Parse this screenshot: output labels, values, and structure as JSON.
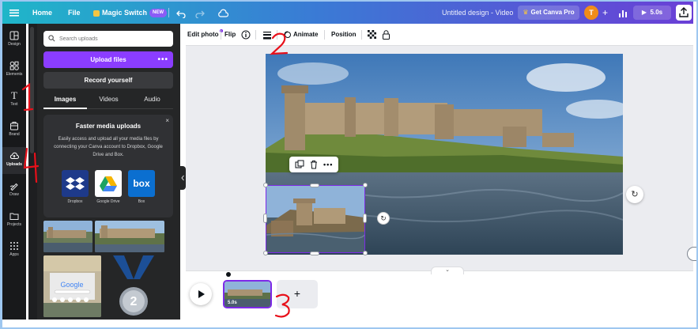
{
  "topbar": {
    "home": "Home",
    "file": "File",
    "magic_switch": "Magic Switch",
    "new_badge": "NEW",
    "doc_title": "Untitled design - Video",
    "get_pro": "Get Canva Pro",
    "avatar_initial": "T",
    "add": "+",
    "duration": "5.0s"
  },
  "rail": {
    "items": [
      {
        "label": "Design",
        "icon": "design-icon"
      },
      {
        "label": "Elements",
        "icon": "elements-icon"
      },
      {
        "label": "Text",
        "icon": "text-icon"
      },
      {
        "label": "Brand",
        "icon": "brand-icon"
      },
      {
        "label": "Uploads",
        "icon": "upload-icon"
      },
      {
        "label": "Draw",
        "icon": "draw-icon"
      },
      {
        "label": "Projects",
        "icon": "folder-icon"
      },
      {
        "label": "Apps",
        "icon": "apps-icon"
      }
    ]
  },
  "panel": {
    "search_placeholder": "Search uploads",
    "upload_button": "Upload files",
    "upload_more": "•••",
    "record_button": "Record yourself",
    "tabs": [
      "Images",
      "Videos",
      "Audio"
    ],
    "promo": {
      "close": "×",
      "title": "Faster media uploads",
      "text": "Easily access and upload all your media files by connecting your Canva account to Dropbox, Google Drive and Box.",
      "services": [
        "Dropbox",
        "Google Drive",
        "Box"
      ],
      "box_logo": "box"
    },
    "medal_number": "2"
  },
  "toolbar": {
    "edit_photo": "Edit photo",
    "flip": "Flip",
    "animate": "Animate",
    "position": "Position"
  },
  "timeline": {
    "clip_duration": "5.0s",
    "add": "+"
  },
  "annotations": [
    "1",
    "2",
    "3",
    "4"
  ],
  "colors": {
    "accent": "#7d2ae8",
    "upload_button": "#8b3dff",
    "annotation": "#e8101a"
  }
}
